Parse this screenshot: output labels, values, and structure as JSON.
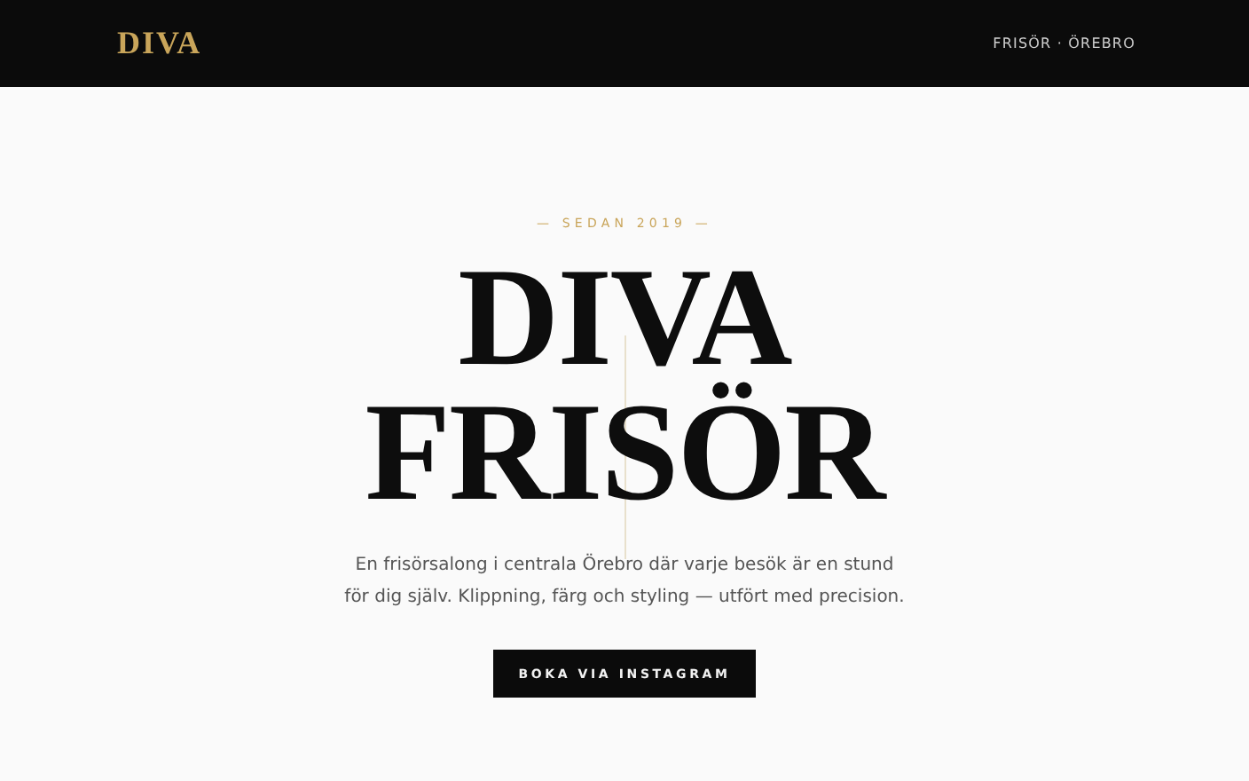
{
  "header": {
    "logo": "DIVA",
    "tagline": "FRISÖR · ÖREBRO"
  },
  "hero": {
    "eyebrow": "— SEDAN 2019 —",
    "title_lines": [
      "DIVA",
      "FRISÖR"
    ],
    "description": "En frisörsalong i centrala Örebro där varje besök är en stund för dig själv. Klippning, färg och styling — utfört med precision.",
    "button": "BOKA VIA INSTAGRAM"
  }
}
